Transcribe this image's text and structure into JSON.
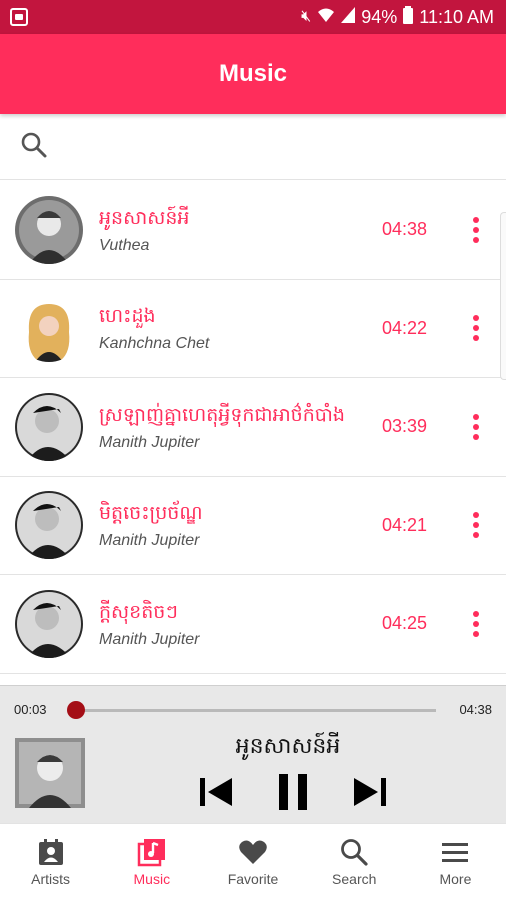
{
  "status_bar": {
    "battery": "94%",
    "time": "11:10 AM"
  },
  "app_bar": {
    "title": "Music"
  },
  "search": {
    "placeholder": ""
  },
  "songs": [
    {
      "title": "អូនសាសន៍អី",
      "artist": "Vuthea",
      "duration": "04:38"
    },
    {
      "title": "ហេះដួង",
      "artist": "Kanhchna Chet",
      "duration": "04:22"
    },
    {
      "title": "ស្រឡាញ់គ្នាហេតុអ្វីទុកជាអាថ៌កំបាំង",
      "artist": "Manith Jupiter",
      "duration": "03:39"
    },
    {
      "title": "មិត្តចេះប្រច័ណ្ឌ",
      "artist": "Manith Jupiter",
      "duration": "04:21"
    },
    {
      "title": "ក្ដីសុខតិចៗ",
      "artist": "Manith Jupiter",
      "duration": "04:25"
    }
  ],
  "player": {
    "current_time": "00:03",
    "total_time": "04:38",
    "progress": 0.011,
    "now_playing_title": "អូនសាសន៍អី"
  },
  "bottom_nav": [
    {
      "label": "Artists",
      "icon": "artists-icon",
      "active": false
    },
    {
      "label": "Music",
      "icon": "music-library-icon",
      "active": true
    },
    {
      "label": "Favorite",
      "icon": "heart-icon",
      "active": false
    },
    {
      "label": "Search",
      "icon": "search-icon",
      "active": false
    },
    {
      "label": "More",
      "icon": "menu-icon",
      "active": false
    }
  ],
  "colors": {
    "status_bar": "#c2153e",
    "accent": "#ff2d5b",
    "progress": "#a40e16",
    "player_bg": "#e8e8e8"
  }
}
